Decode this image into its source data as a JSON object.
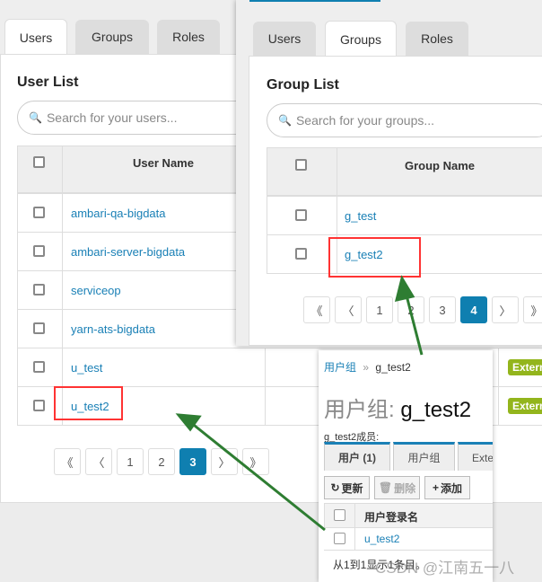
{
  "users_panel": {
    "tabs": [
      "Users",
      "Groups",
      "Roles"
    ],
    "active_tab": "Users",
    "title": "User List",
    "search_placeholder": "Search for your users...",
    "column": "User Name",
    "rows": [
      "ambari-qa-bigdata",
      "ambari-server-bigdata",
      "serviceop",
      "yarn-ats-bigdata",
      "u_test",
      "u_test2"
    ],
    "badges": [
      "Extern",
      "Extern"
    ],
    "pagination": [
      "《",
      "〈",
      "1",
      "2",
      "3",
      "〉",
      "》"
    ],
    "current_page": "3"
  },
  "groups_panel": {
    "tabs": [
      "Users",
      "Groups",
      "Roles"
    ],
    "active_tab": "Groups",
    "title": "Group List",
    "search_placeholder": "Search for your groups...",
    "column": "Group Name",
    "rows": [
      "g_test",
      "g_test2"
    ],
    "pagination": [
      "《",
      "〈",
      "1",
      "2",
      "3",
      "4",
      "〉",
      "》"
    ],
    "current_page": "4"
  },
  "detail_panel": {
    "breadcrumb_root": "用户组",
    "breadcrumb_sep": "»",
    "breadcrumb_current": "g_test2",
    "title_prefix": "用户组:",
    "title_name": "g_test2",
    "members_label": "g_test2成员:",
    "tabs": [
      "用户 (1)",
      "用户组",
      "Exte"
    ],
    "buttons": {
      "refresh": "更新",
      "delete": "删除",
      "add": "添加"
    },
    "column": "用户登录名",
    "rows": [
      "u_test2"
    ],
    "footer": "从1到1显示1条目。"
  },
  "watermark": "CSDN @江南五一八",
  "colors": {
    "accent": "#0f7fb0",
    "link": "#1a80b6",
    "highlight": "#ff3333",
    "arrow": "#2e7d32",
    "badge": "#93b51c"
  }
}
